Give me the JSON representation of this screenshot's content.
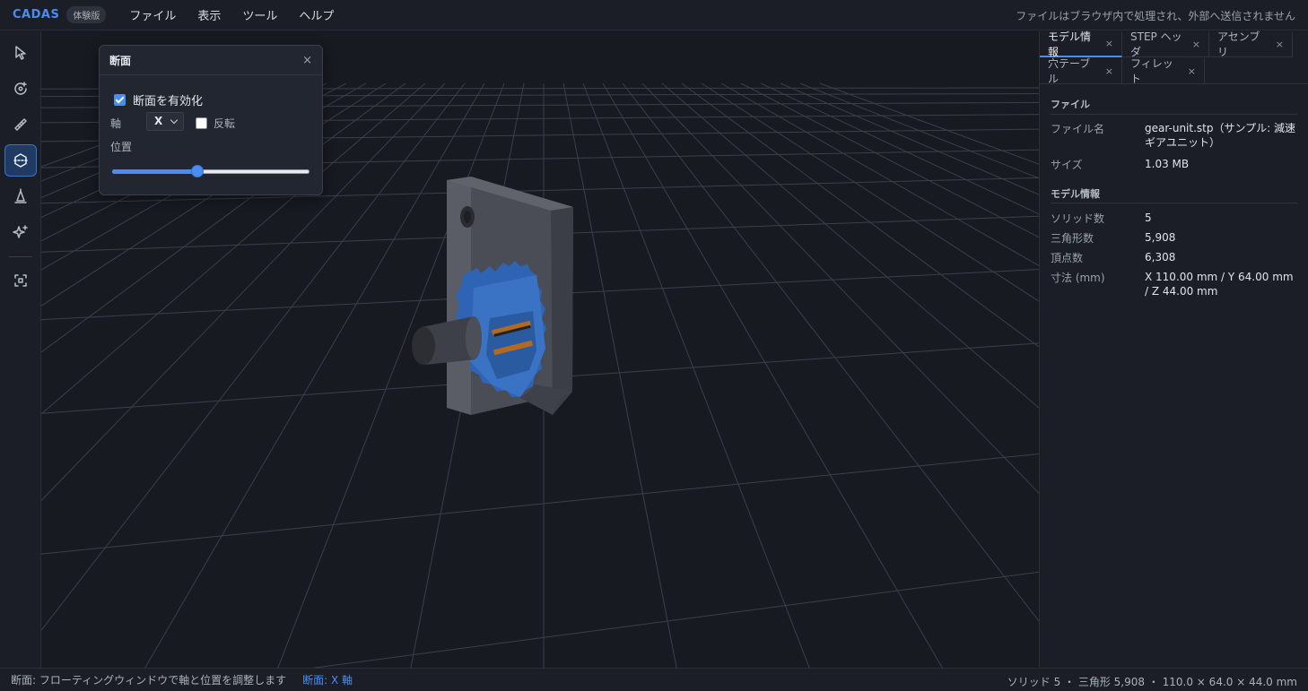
{
  "app": {
    "brand": "CADAS",
    "badge": "体験版",
    "menu": [
      "ファイル",
      "表示",
      "ツール",
      "ヘルプ"
    ],
    "privacy_note": "ファイルはブラウザ内で処理され、外部へ送信されません"
  },
  "toolbar": {
    "tools": [
      {
        "name": "select",
        "icon": "cursor-arrow-icon",
        "active": false
      },
      {
        "name": "orbit",
        "icon": "orbit-icon",
        "active": false
      },
      {
        "name": "measure",
        "icon": "ruler-icon",
        "active": false
      },
      {
        "name": "section",
        "icon": "section-plane-icon",
        "active": true
      },
      {
        "name": "draft",
        "icon": "draft-analysis-icon",
        "active": false
      },
      {
        "name": "effects",
        "icon": "sparkle-icon",
        "active": false
      },
      {
        "name": "fit",
        "icon": "fit-view-icon",
        "active": false
      }
    ]
  },
  "section_panel": {
    "title": "断面",
    "close": "×",
    "enable_label": "断面を有効化",
    "enabled": true,
    "axis_label": "軸",
    "axis_value": "X",
    "flip_label": "反転",
    "flip": false,
    "position_label": "位置",
    "position": 0.43
  },
  "right_panel": {
    "tabs": [
      {
        "label": "モデル情報",
        "active": true
      },
      {
        "label": "STEP ヘッダ",
        "active": false
      },
      {
        "label": "アセンブリ",
        "active": false
      },
      {
        "label": "穴テーブル",
        "active": false
      },
      {
        "label": "フィレット",
        "active": false
      }
    ],
    "close_glyph": "×",
    "file_section": {
      "title": "ファイル",
      "filename_key": "ファイル名",
      "filename_value": "gear-unit.stp（サンプル: 減速ギアユニット）",
      "size_key": "サイズ",
      "size_value": "1.03 MB"
    },
    "model_section": {
      "title": "モデル情報",
      "solids_key": "ソリッド数",
      "solids_value": "5",
      "triangles_key": "三角形数",
      "triangles_value": "5,908",
      "vertices_key": "頂点数",
      "vertices_value": "6,308",
      "dims_key": "寸法 (mm)",
      "dims_value": "X 110.00 mm / Y 64.00 mm / Z 44.00 mm"
    }
  },
  "status": {
    "hint": "断面: フローティングウィンドウで軸と位置を調整します",
    "mode": "断面: X 軸",
    "stats": "ソリッド 5 ・ 三角形 5,908 ・ 110.0 × 64.0 × 44.0 mm"
  },
  "colors": {
    "accent": "#4a8df0",
    "background": "#171a21",
    "gear": "#2f64b4",
    "plate": "#4a4d55"
  }
}
